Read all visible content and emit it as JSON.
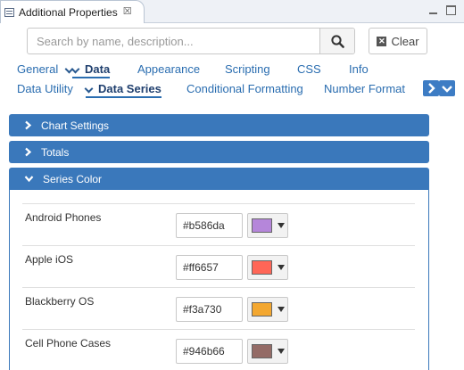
{
  "view": {
    "title": "Additional Properties",
    "close_glyph": "☒"
  },
  "search": {
    "placeholder": "Search by name, description...",
    "value": "",
    "clear_label": "Clear"
  },
  "tabs_primary": [
    {
      "label": "General",
      "has_menu": true,
      "active": false
    },
    {
      "label": "Data",
      "has_menu": true,
      "active": true
    },
    {
      "label": "Appearance",
      "active": false
    },
    {
      "label": "Scripting",
      "active": false
    },
    {
      "label": "CSS",
      "active": false
    },
    {
      "label": "Info",
      "active": false
    }
  ],
  "tabs_secondary": [
    {
      "label": "Data Utility",
      "active": false
    },
    {
      "label": "Data Series",
      "has_menu": true,
      "active": true
    },
    {
      "label": "Conditional Formatting",
      "active": false
    },
    {
      "label": "Number Format",
      "active": false
    }
  ],
  "sections": [
    {
      "label": "Chart Settings",
      "expanded": false
    },
    {
      "label": "Totals",
      "expanded": false
    },
    {
      "label": "Series Color",
      "expanded": true
    }
  ],
  "series_colors": [
    {
      "name": "Android Phones",
      "hex": "#b586da"
    },
    {
      "name": "Apple iOS",
      "hex": "#ff6657"
    },
    {
      "name": "Blackberry OS",
      "hex": "#f3a730"
    },
    {
      "name": "Cell Phone Cases",
      "hex": "#946b66"
    }
  ],
  "colors": {
    "accent": "#3a78bb",
    "link": "#2a6db0",
    "active_tab": "#1f3f6e"
  },
  "icons": {
    "search": "search-icon",
    "clear": "clear-x-icon",
    "section_collapsed": "chevron-right-icon",
    "section_expanded": "chevron-down-icon",
    "scroll_tabs_right": "chevron-right-icon",
    "tabs_menu": "chevron-down-icon"
  }
}
